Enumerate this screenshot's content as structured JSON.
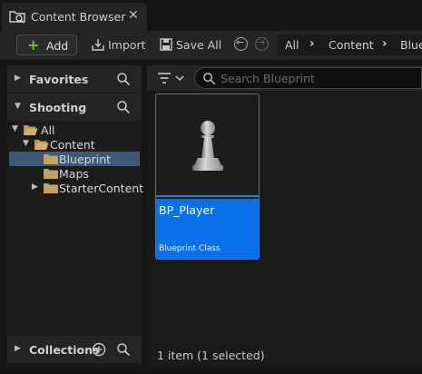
{
  "tab": {
    "title": "Content Browser",
    "close": "✕"
  },
  "toolbar": {
    "add_label": "Add",
    "import_label": "Import",
    "save_all_label": "Save All",
    "breadcrumbs": [
      "All",
      "Content",
      "Blueprint"
    ]
  },
  "sidebar": {
    "favorites_title": "Favorites",
    "project_title": "Shooting",
    "collections_title": "Collections",
    "tree": [
      {
        "label": "All",
        "depth": 0,
        "expanded": true,
        "selected": false
      },
      {
        "label": "Content",
        "depth": 1,
        "expanded": true,
        "selected": false
      },
      {
        "label": "Blueprint",
        "depth": 2,
        "expanded": false,
        "selected": true
      },
      {
        "label": "Maps",
        "depth": 2,
        "expanded": false,
        "selected": false
      },
      {
        "label": "StarterContent",
        "depth": 2,
        "expanded": false,
        "collapsed_arrow": true,
        "selected": false
      }
    ]
  },
  "content": {
    "search_placeholder": "Search Blueprint",
    "assets": [
      {
        "name": "BP_Player",
        "type": "Blueprint Class",
        "selected": true
      }
    ],
    "status": "1 item (1 selected)"
  },
  "colors": {
    "accent": "#0c70e8",
    "selection": "#3c5a78",
    "add_green": "#6fbf3b",
    "folder": "#c2a06a"
  }
}
